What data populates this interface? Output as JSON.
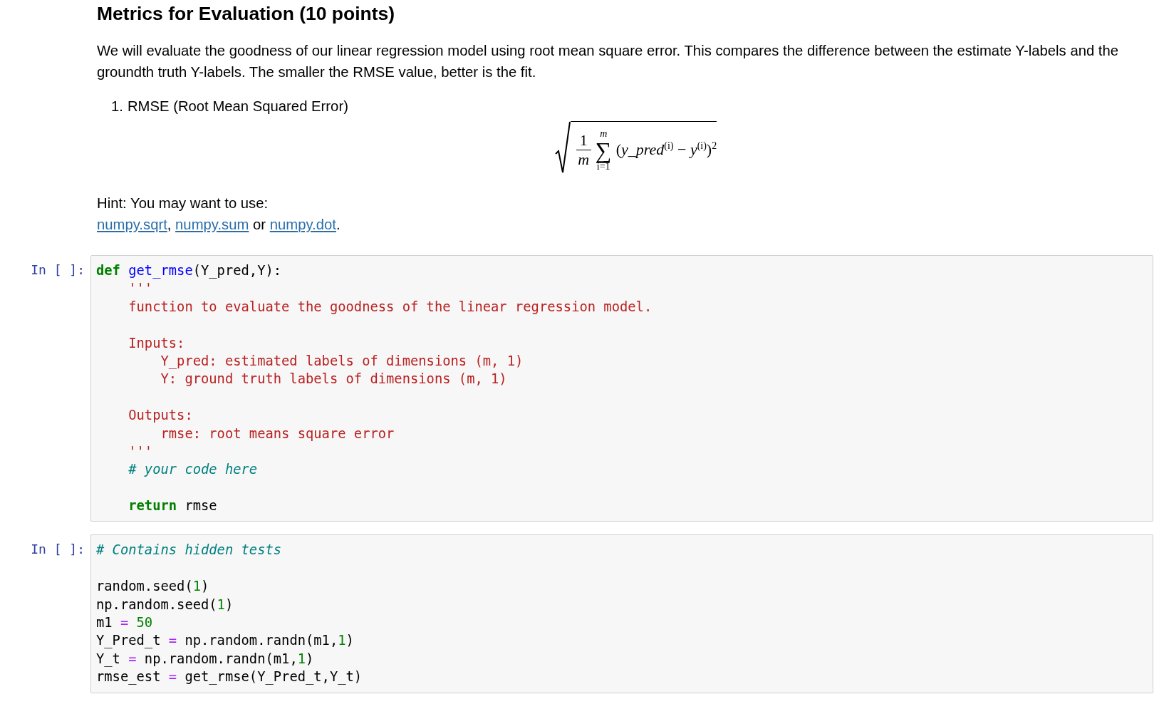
{
  "heading": "Metrics for Evaluation (10 points)",
  "paragraph": "We will evaluate the goodness of our linear regression model using root mean square error. This compares the difference between the estimate Y-labels and the groundth truth Y-labels. The smaller the RMSE value, better is the fit.",
  "list": [
    {
      "number": "1.",
      "text": "RMSE (Root Mean Squared Error)"
    }
  ],
  "formula": {
    "numerator": "1",
    "denominator": "m",
    "sum_sign": "∑",
    "sum_upper": "m",
    "sum_lower": "i=1",
    "body": "(*y_pred*$^{(i)}$ − *y*$^{(i)}$)$^{2}$"
  },
  "hint": {
    "text": "Hint: You may want to use:",
    "parts": [
      {
        "kind": "link",
        "text": "numpy.sqrt"
      },
      {
        "kind": "text",
        "text": ", "
      },
      {
        "kind": "link",
        "text": "numpy.sum"
      },
      {
        "kind": "text",
        "text": " or "
      },
      {
        "kind": "link",
        "text": "numpy.dot"
      },
      {
        "kind": "text",
        "text": "."
      }
    ]
  },
  "cells": [
    {
      "prompt": "In [ ]:",
      "lines": [
        {
          "kind": "code",
          "tokens": [
            {
              "kind": "keyword",
              "text": "def"
            },
            {
              "kind": "function",
              "text": " get_rmse"
            },
            {
              "kind": "plain",
              "text": "(Y_pred,Y):"
            }
          ]
        },
        {
          "kind": "code",
          "tokens": [
            {
              "kind": "string",
              "text": "    '''"
            }
          ]
        },
        {
          "kind": "code",
          "tokens": [
            {
              "kind": "string",
              "text": "    function to evaluate the goodness of the linear regression model."
            }
          ]
        },
        {
          "kind": "blank"
        },
        {
          "kind": "code",
          "tokens": [
            {
              "kind": "string",
              "text": "    Inputs:"
            }
          ]
        },
        {
          "kind": "code",
          "tokens": [
            {
              "kind": "string",
              "text": "        Y_pred: estimated labels of dimensions (m, 1)"
            }
          ]
        },
        {
          "kind": "code",
          "tokens": [
            {
              "kind": "string",
              "text": "        Y: ground truth labels of dimensions (m, 1)"
            }
          ]
        },
        {
          "kind": "blank"
        },
        {
          "kind": "code",
          "tokens": [
            {
              "kind": "string",
              "text": "    Outputs:"
            }
          ]
        },
        {
          "kind": "code",
          "tokens": [
            {
              "kind": "string",
              "text": "        rmse: root means square error"
            }
          ]
        },
        {
          "kind": "code",
          "tokens": [
            {
              "kind": "string",
              "text": "    '''"
            }
          ]
        },
        {
          "kind": "code",
          "tokens": [
            {
              "kind": "comment",
              "text": "    # your code here"
            }
          ]
        },
        {
          "kind": "blank"
        },
        {
          "kind": "code",
          "tokens": [
            {
              "kind": "keyword",
              "text": "    return"
            },
            {
              "kind": "plain",
              "text": " rmse"
            }
          ]
        }
      ]
    },
    {
      "prompt": "In [ ]:",
      "lines": [
        {
          "kind": "code",
          "tokens": [
            {
              "kind": "comment",
              "text": "# Contains hidden tests"
            }
          ]
        },
        {
          "kind": "blank"
        },
        {
          "kind": "code",
          "tokens": [
            {
              "kind": "plain",
              "text": "random.seed("
            },
            {
              "kind": "number",
              "text": "1"
            },
            {
              "kind": "plain",
              "text": ")"
            }
          ]
        },
        {
          "kind": "code",
          "tokens": [
            {
              "kind": "plain",
              "text": "np.random.seed("
            },
            {
              "kind": "number",
              "text": "1"
            },
            {
              "kind": "plain",
              "text": ")"
            }
          ]
        },
        {
          "kind": "code",
          "tokens": [
            {
              "kind": "plain",
              "text": "m1 "
            },
            {
              "kind": "operator",
              "text": "="
            },
            {
              "kind": "number",
              "text": " 50"
            }
          ]
        },
        {
          "kind": "code",
          "tokens": [
            {
              "kind": "plain",
              "text": "Y_Pred_t "
            },
            {
              "kind": "operator",
              "text": "="
            },
            {
              "kind": "plain",
              "text": " np.random.randn(m1,"
            },
            {
              "kind": "number",
              "text": "1"
            },
            {
              "kind": "plain",
              "text": ")"
            }
          ]
        },
        {
          "kind": "code",
          "tokens": [
            {
              "kind": "plain",
              "text": "Y_t "
            },
            {
              "kind": "operator",
              "text": "="
            },
            {
              "kind": "plain",
              "text": " np.random.randn(m1,"
            },
            {
              "kind": "number",
              "text": "1"
            },
            {
              "kind": "plain",
              "text": ")"
            }
          ]
        },
        {
          "kind": "code",
          "tokens": [
            {
              "kind": "plain",
              "text": "rmse_est "
            },
            {
              "kind": "operator",
              "text": "="
            },
            {
              "kind": "plain",
              "text": " get_rmse(Y_Pred_t,Y_t)"
            }
          ]
        }
      ]
    }
  ]
}
